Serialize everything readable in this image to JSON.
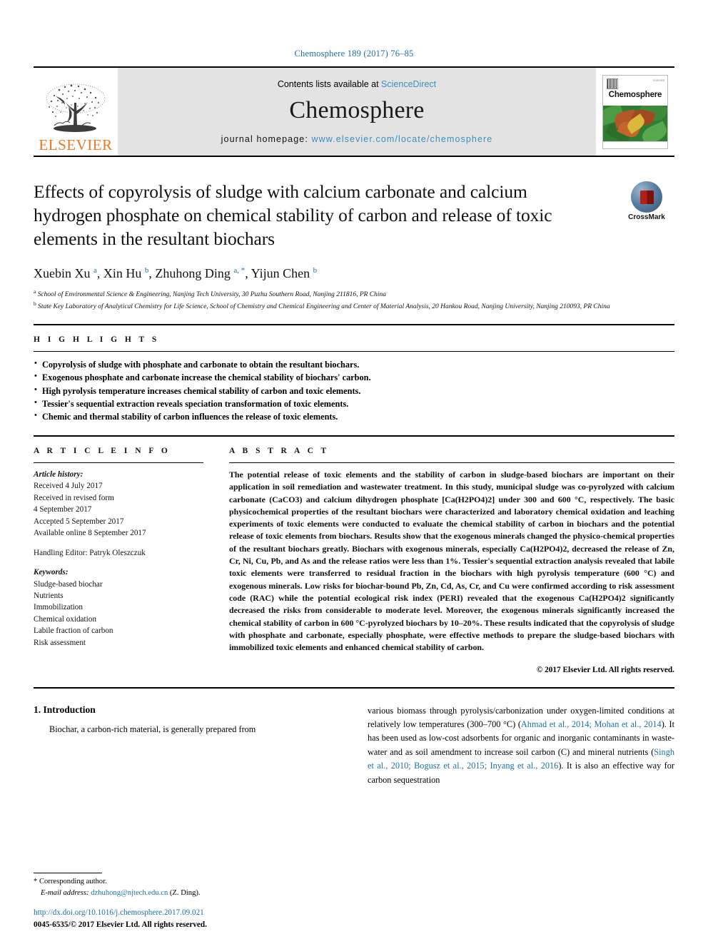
{
  "running_head": "Chemosphere 189 (2017) 76–85",
  "masthead": {
    "publisher_name": "ELSEVIER",
    "contents_prefix": "Contents lists available at ",
    "contents_link": "ScienceDirect",
    "journal_title": "Chemosphere",
    "homepage_prefix": "journal homepage: ",
    "homepage_url": "www.elsevier.com/locate/chemosphere",
    "cover_title": "Chemosphere",
    "cover_publisher": "ELSEVIER"
  },
  "article": {
    "title": "Effects of copyrolysis of sludge with calcium carbonate and calcium hydrogen phosphate on chemical stability of carbon and release of toxic elements in the resultant biochars",
    "crossmark_label": "CrossMark",
    "authors": [
      {
        "name": "Xuebin Xu",
        "sup": "a"
      },
      {
        "name": "Xin Hu",
        "sup": "b"
      },
      {
        "name": "Zhuhong Ding",
        "sup": "a, *"
      },
      {
        "name": "Yijun Chen",
        "sup": "b"
      }
    ],
    "affiliations": [
      {
        "mark": "a",
        "text": "School of Environmental Science & Engineering, Nanjing Tech University, 30 Puzhu Southern Road, Nanjing 211816, PR China"
      },
      {
        "mark": "b",
        "text": "State Key Laboratory of Analytical Chemistry for Life Science, School of Chemistry and Chemical Engineering and Center of Material Analysis, 20 Hankou Road, Nanjing University, Nanjing 210093, PR China"
      }
    ]
  },
  "highlights": {
    "label": "H I G H L I G H T S",
    "items": [
      "Copyrolysis of sludge with phosphate and carbonate to obtain the resultant biochars.",
      "Exogenous phosphate and carbonate increase the chemical stability of biochars' carbon.",
      "High pyrolysis temperature increases chemical stability of carbon and toxic elements.",
      "Tessier's sequential extraction reveals speciation transformation of toxic elements.",
      "Chemic and thermal stability of carbon influences the release of toxic elements."
    ]
  },
  "article_info": {
    "label": "A R T I C L E   I N F O",
    "history_heading": "Article history:",
    "history": [
      "Received 4 July 2017",
      "Received in revised form",
      "4 September 2017",
      "Accepted 5 September 2017",
      "Available online 8 September 2017"
    ],
    "handling_editor": "Handling Editor: Patryk Oleszczuk",
    "keywords_heading": "Keywords:",
    "keywords": [
      "Sludge-based biochar",
      "Nutrients",
      "Immobilization",
      "Chemical oxidation",
      "Labile fraction of carbon",
      "Risk assessment"
    ]
  },
  "abstract": {
    "label": "A B S T R A C T",
    "text": "The potential release of toxic elements and the stability of carbon in sludge-based biochars are important on their application in soil remediation and wastewater treatment. In this study, municipal sludge was co-pyrolyzed with calcium carbonate (CaCO3) and calcium dihydrogen phosphate [Ca(H2PO4)2] under 300 and 600 °C, respectively. The basic physicochemical properties of the resultant biochars were characterized and laboratory chemical oxidation and leaching experiments of toxic elements were conducted to evaluate the chemical stability of carbon in biochars and the potential release of toxic elements from biochars. Results show that the exogenous minerals changed the physico-chemical properties of the resultant biochars greatly. Biochars with exogenous minerals, especially Ca(H2PO4)2, decreased the release of Zn, Cr, Ni, Cu, Pb, and As and the release ratios were less than 1%. Tessier's sequential extraction analysis revealed that labile toxic elements were transferred to residual fraction in the biochars with high pyrolysis temperature (600 °C) and exogenous minerals. Low risks for biochar-bound Pb, Zn, Cd, As, Cr, and Cu were confirmed according to risk assessment code (RAC) while the potential ecological risk index (PERI) revealed that the exogenous Ca(H2PO4)2 significantly decreased the risks from considerable to moderate level. Moreover, the exogenous minerals significantly increased the chemical stability of carbon in 600 °C-pyrolyzed biochars by 10–20%. These results indicated that the copyrolysis of sludge with phosphate and carbonate, especially phosphate, were effective methods to prepare the sludge-based biochars with immobilized toxic elements and enhanced chemical stability of carbon.",
    "copyright": "© 2017 Elsevier Ltd. All rights reserved."
  },
  "intro": {
    "section_number_title": "1.  Introduction",
    "left_paragraph": "Biochar, a carbon-rich material, is generally prepared from",
    "right_paragraph_parts": [
      {
        "text": "various biomass through pyrolysis/carbonization under oxygen-limited conditions at relatively low temperatures (300–700 °C) (",
        "type": "plain"
      },
      {
        "text": "Ahmad et al., 2014; Mohan et al., 2014",
        "type": "ref"
      },
      {
        "text": "). It has been used as low-cost adsorbents for organic and inorganic contaminants in waste-water and as soil amendment to increase soil carbon (C) and mineral nutrients (",
        "type": "plain"
      },
      {
        "text": "Singh et al., 2010; Bogusz et al., 2015; Inyang et al., 2016",
        "type": "ref"
      },
      {
        "text": "). It is also an effective way for carbon sequestration",
        "type": "plain"
      }
    ]
  },
  "footer": {
    "corresponding_marker": "*",
    "corresponding_text": "Corresponding author.",
    "email_label": "E-mail address:",
    "email": "dzhuhong@njtech.edu.cn",
    "email_suffix": "(Z. Ding).",
    "doi": "http://dx.doi.org/10.1016/j.chemosphere.2017.09.021",
    "issn_line": "0045-6535/© 2017 Elsevier Ltd. All rights reserved."
  },
  "colors": {
    "link_blue": "#1a6fa5",
    "elsevier_orange": "#E87722",
    "masthead_gray": "#e3e3e3"
  }
}
